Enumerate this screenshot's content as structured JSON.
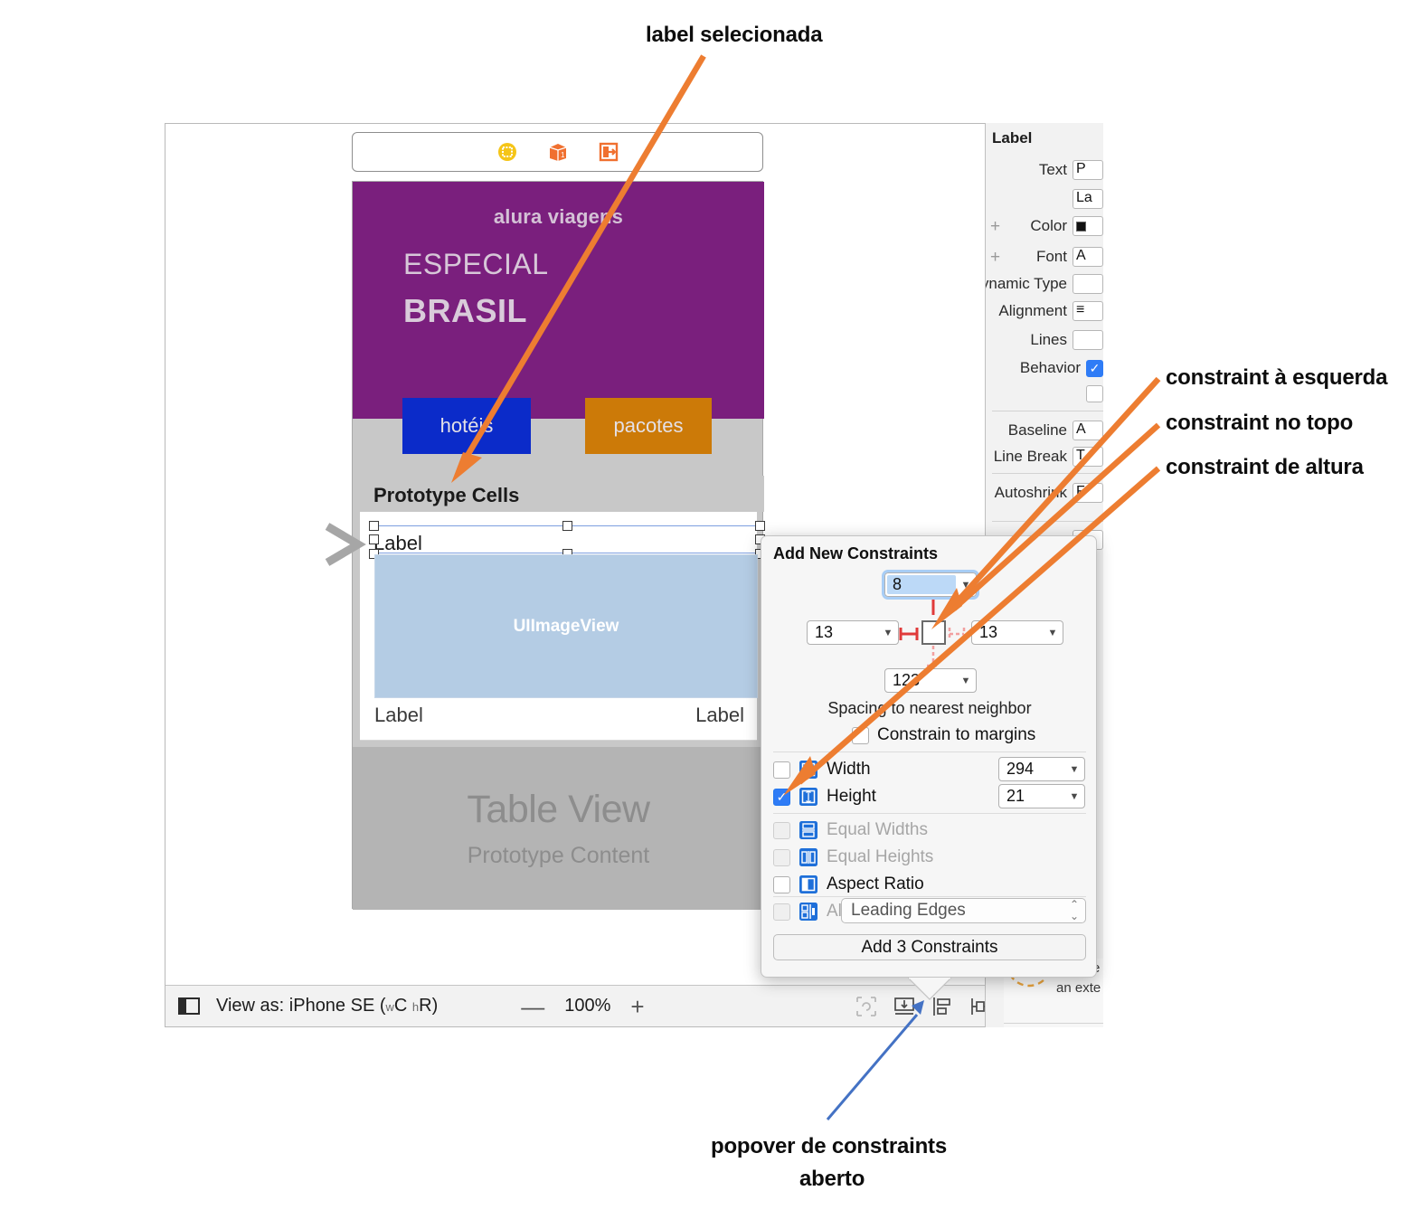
{
  "annotations": {
    "top": "label selecionada",
    "right_1": "constraint à esquerda",
    "right_2": "constraint no topo",
    "right_3": "constraint de altura",
    "bottom_1": "popover de constraints",
    "bottom_2": "aberto",
    "orange": "#ED7D31",
    "blue": "#4472C4",
    "gray": "#A6A6A6"
  },
  "scene_dock": {
    "icons": [
      {
        "name": "view-controller-icon",
        "color": "#F5C518"
      },
      {
        "name": "first-responder-icon",
        "color": "#F07030"
      },
      {
        "name": "exit-icon",
        "color": "#F07030"
      }
    ]
  },
  "device": {
    "banner": {
      "brand": "alura viagens",
      "line1": "ESPECIAL",
      "line2": "BRASIL",
      "bg": "#7A1F7D",
      "text_color": "#D6C6D8"
    },
    "buttons": [
      {
        "label": "hotéis",
        "bg": "#0B2BC9"
      },
      {
        "label": "pacotes",
        "bg": "#CC7A08"
      }
    ],
    "prototype_cells_title": "Prototype Cells",
    "cell": {
      "selected_label": "Label",
      "image_view": "UIImageView",
      "image_view_bg": "#B4CCE4",
      "bottom_left_label": "Label",
      "bottom_right_label": "Label"
    },
    "table_view": {
      "title": "Table View",
      "subtitle": "Prototype Content",
      "bg": "#B4B4B4"
    }
  },
  "bottom_bar": {
    "view_as_prefix": "View as: ",
    "device": "iPhone SE ",
    "traits_open": "(",
    "trait_w_small": "w",
    "trait_w": "C ",
    "trait_h_small": "h",
    "trait_h": "R)",
    "zoom_out": "—",
    "zoom_value": "100%",
    "zoom_in": "+",
    "tools": [
      "update-frames-icon",
      "embed-in-icon",
      "align-icon",
      "add-new-constraints-icon",
      "resolve-auto-layout-icon"
    ]
  },
  "inspector": {
    "title": "Label",
    "rows": [
      {
        "label": "Text",
        "value": "P"
      },
      {
        "label": "",
        "value": "La"
      },
      {
        "label": "Color",
        "value": "",
        "plus": true,
        "swatch": "#111111"
      },
      {
        "label": "Font",
        "value": "A",
        "plus": true
      },
      {
        "label": "Dynamic Type",
        "value": ""
      },
      {
        "label": "Alignment",
        "value": "≡"
      },
      {
        "label": "Lines",
        "value": ""
      },
      {
        "label": "Behavior",
        "value": "",
        "checked": true
      },
      {
        "label": "",
        "value": ""
      },
      {
        "label": "Baseline",
        "value": "A"
      },
      {
        "label": "Line Break",
        "value": "T"
      },
      {
        "label": "Autoshrink",
        "value": "F"
      }
    ]
  },
  "fragment_panel": {
    "line1": "a place",
    "line2": "an exte"
  },
  "popover": {
    "title": "Add New Constraints",
    "spacing": {
      "top": "8",
      "left": "13",
      "right": "13",
      "bottom": "123"
    },
    "spacing_caption": "Spacing to nearest neighbor",
    "constrain_to_margins": {
      "label": "Constrain to margins",
      "checked": false
    },
    "size_rows": [
      {
        "name": "width-row",
        "label": "Width",
        "checked": false,
        "value": "294",
        "icon": "width-constraint-icon",
        "enabled": true
      },
      {
        "name": "height-row",
        "label": "Height",
        "checked": true,
        "value": "21",
        "icon": "height-constraint-icon",
        "enabled": true
      }
    ],
    "relation_rows": [
      {
        "name": "equal-widths-row",
        "label": "Equal Widths",
        "checked": false,
        "enabled": false,
        "icon": "equal-widths-icon"
      },
      {
        "name": "equal-heights-row",
        "label": "Equal Heights",
        "checked": false,
        "enabled": false,
        "icon": "equal-heights-icon"
      },
      {
        "name": "aspect-ratio-row",
        "label": "Aspect Ratio",
        "checked": false,
        "enabled": true,
        "icon": "aspect-ratio-icon"
      }
    ],
    "align": {
      "label": "Align",
      "value": "Leading Edges",
      "checked": false,
      "enabled": false,
      "icon": "align-icon"
    },
    "add_button": "Add 3 Constraints"
  }
}
